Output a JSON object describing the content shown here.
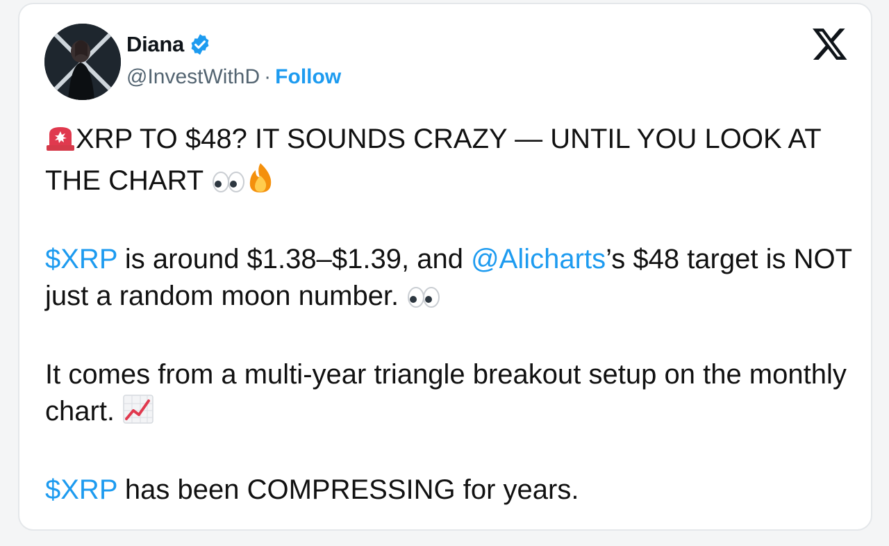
{
  "tweet": {
    "author": {
      "display_name": "Diana",
      "verified": true,
      "handle": "@InvestWithD",
      "separator": "·",
      "follow_label": "Follow"
    },
    "brand_icon": "x-logo-icon",
    "paragraphs": [
      {
        "icon_lead": "rotating-light-icon",
        "text": "XRP TO $48? IT SOUNDS CRAZY — UNTIL YOU LOOK AT THE CHART",
        "icons_trail": [
          "eyes-icon",
          "fire-icon"
        ]
      },
      {
        "cashtag": "$XRP",
        "text_a": " is around $1.38–$1.39, and ",
        "mention": "@Alicharts",
        "text_b": "’s $48 target is NOT just a random moon number.",
        "icons_trail": [
          "eyes-icon"
        ]
      },
      {
        "text": "It comes from a multi-year triangle breakout setup on the monthly chart.",
        "icons_trail": [
          "chart-increasing-icon"
        ]
      },
      {
        "cashtag": "$XRP",
        "text": " has been COMPRESSING for years."
      }
    ],
    "colors": {
      "link": "#1d9bf0",
      "verified": "#1d9bf0",
      "text": "#0f1419",
      "muted": "#536471"
    }
  }
}
